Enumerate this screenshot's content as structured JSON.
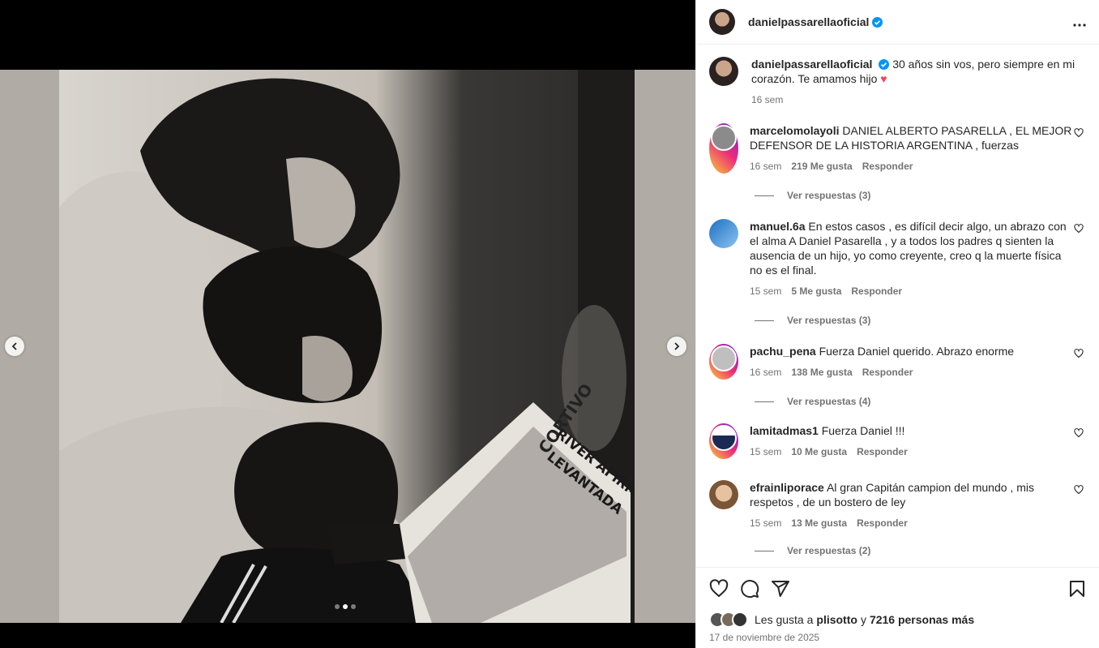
{
  "post": {
    "author": "danielpassarellaoficial",
    "caption_text": "30 años sin vos, pero siempre en mi corazón. Te amamos hijo",
    "caption_emoji": "♥",
    "caption_time": "16 sem"
  },
  "media": {
    "newspaper_headline_1": "RIVER AFIRMO",
    "newspaper_headline_2": "LEVANTADA",
    "newspaper_masthead": "CORTIVO",
    "carousel_dots": 3,
    "carousel_active": 2
  },
  "comments": [
    {
      "user": "marcelomolayoli",
      "text": "DANIEL ALBERTO PASARELLA , EL MEJOR DEFENSOR DE LA HISTORIA ARGENTINA , fuerzas",
      "time": "16 sem",
      "likes": "219 Me gusta",
      "reply": "Responder",
      "view_replies": "Ver respuestas (3)"
    },
    {
      "user": "manuel.6a",
      "text": "En estos casos , es difícil decir algo, un abrazo con el alma A Daniel Pasarella , y a todos los padres q sienten la ausencia de un hijo, yo como creyente, creo q la muerte física no es el final.",
      "time": "15 sem",
      "likes": "5 Me gusta",
      "reply": "Responder",
      "view_replies": "Ver respuestas (3)"
    },
    {
      "user": "pachu_pena",
      "text": "Fuerza Daniel querido. Abrazo enorme",
      "time": "16 sem",
      "likes": "138 Me gusta",
      "reply": "Responder",
      "view_replies": "Ver respuestas (4)"
    },
    {
      "user": "lamitadmas1",
      "text": "Fuerza Daniel !!!",
      "time": "15 sem",
      "likes": "10 Me gusta",
      "reply": "Responder",
      "view_replies": ""
    },
    {
      "user": "efrainliporace",
      "text": "Al gran Capitán campion del mundo , mis respetos , de un bostero de ley",
      "time": "15 sem",
      "likes": "13 Me gusta",
      "reply": "Responder",
      "view_replies": "Ver respuestas (2)"
    }
  ],
  "footer": {
    "likes_prefix": "Les gusta a",
    "likes_user": "plisotto",
    "likes_join": "y",
    "likes_others": "7216 personas más",
    "date": "17 de noviembre de 2025"
  },
  "colors": {
    "verified": "#0095f6",
    "secondary_text": "#737373",
    "heart": "#ed4956"
  },
  "icons": [
    "more-icon",
    "heart-icon",
    "comment-icon",
    "share-icon",
    "save-icon",
    "chevron-left-icon",
    "chevron-right-icon",
    "verified-icon"
  ]
}
